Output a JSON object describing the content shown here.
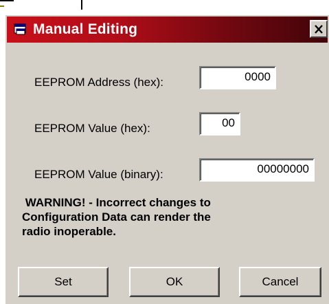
{
  "window": {
    "title": "Manual Editing",
    "close_label": "X",
    "title_gradient_start": "#c8101a",
    "title_gradient_end": "#400408"
  },
  "fields": {
    "address": {
      "label": "EEPROM Address (hex):",
      "value": "0000"
    },
    "value_hex": {
      "label": "EEPROM Value (hex):",
      "value": "00"
    },
    "value_binary": {
      "label": "EEPROM Value (binary):",
      "value": "00000000"
    }
  },
  "warning": {
    "line1": " WARNING! - Incorrect changes to",
    "line2": "Configuration Data can render the",
    "line3": "radio inoperable."
  },
  "buttons": {
    "set": "Set",
    "ok": "OK",
    "cancel": "Cancel"
  },
  "icons": {
    "app": "window-icon",
    "close": "close-icon"
  }
}
